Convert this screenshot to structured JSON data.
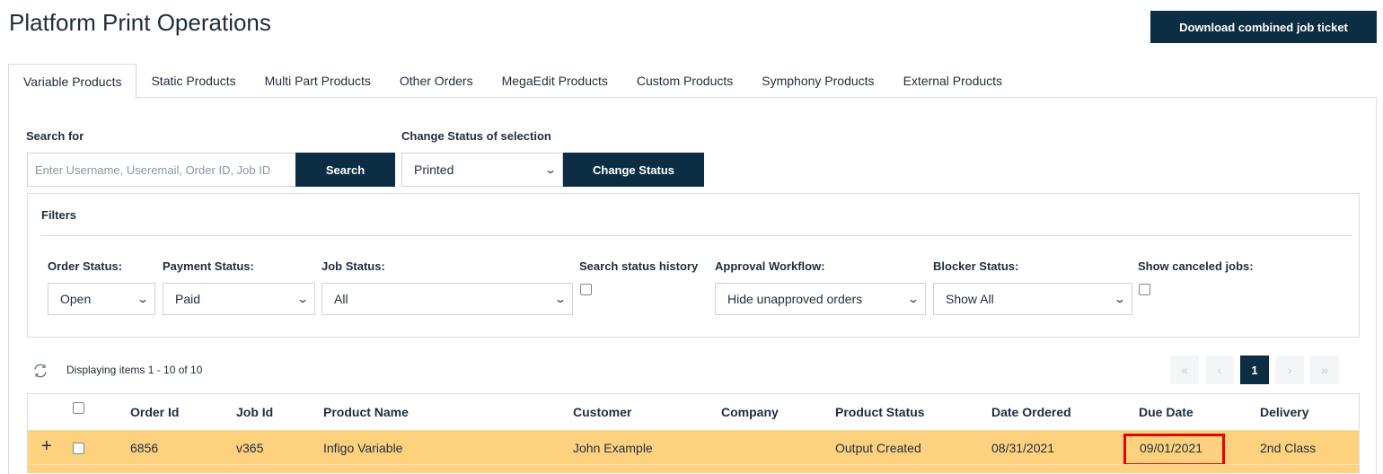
{
  "header": {
    "title": "Platform Print Operations",
    "download_label": "Download combined job ticket"
  },
  "tabs": [
    {
      "label": "Variable Products",
      "active": true
    },
    {
      "label": "Static Products"
    },
    {
      "label": "Multi Part Products"
    },
    {
      "label": "Other Orders"
    },
    {
      "label": "MegaEdit Products"
    },
    {
      "label": "Custom Products"
    },
    {
      "label": "Symphony Products"
    },
    {
      "label": "External Products"
    }
  ],
  "search": {
    "label": "Search for",
    "placeholder": "Enter Username, Useremail, Order ID, Job ID",
    "value": "",
    "button_label": "Search"
  },
  "change_status": {
    "label": "Change Status of selection",
    "selected": "Printed",
    "button_label": "Change Status"
  },
  "filters": {
    "title": "Filters",
    "order_status": {
      "label": "Order Status:",
      "selected": "Open"
    },
    "payment_status": {
      "label": "Payment Status:",
      "selected": "Paid"
    },
    "job_status": {
      "label": "Job Status:",
      "selected": "All"
    },
    "search_history": {
      "label": "Search status history",
      "checked": false
    },
    "approval_workflow": {
      "label": "Approval Workflow:",
      "selected": "Hide unapproved orders"
    },
    "blocker_status": {
      "label": "Blocker Status:",
      "selected": "Show All"
    },
    "show_canceled": {
      "label": "Show canceled jobs:",
      "checked": false
    }
  },
  "grid": {
    "display_text": "Displaying items 1 - 10 of 10",
    "current_page": "1",
    "columns": [
      "Order Id",
      "Job Id",
      "Product Name",
      "Customer",
      "Company",
      "Product Status",
      "Date Ordered",
      "Due Date",
      "Delivery"
    ],
    "rows": [
      {
        "order_id": "6856",
        "job_id": "v365",
        "product_name": "Infigo Variable",
        "customer": "John Example",
        "company": "",
        "product_status": "Output Created",
        "date_ordered": "08/31/2021",
        "due_date": "09/01/2021",
        "delivery": "2nd Class"
      }
    ]
  },
  "colors": {
    "primary_dark": "#0d2d44",
    "row_highlight": "#fdd17e",
    "annotation_red": "#e10600"
  },
  "icons": {
    "refresh": "refresh-icon",
    "expand": "plus-icon",
    "select_chevron": "chevron-down-icon"
  }
}
